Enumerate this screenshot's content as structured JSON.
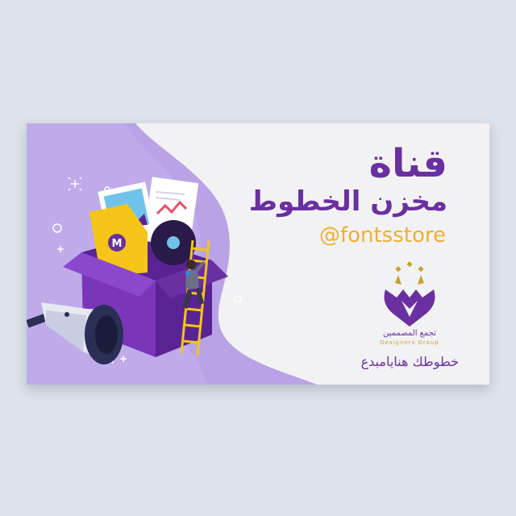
{
  "card": {
    "title_line1": "قناة",
    "title_line2": "مخزن الخطوط",
    "handle": "@fontsstore",
    "logo_arabic": "تجمع المصممين",
    "logo_english": "Designers Group",
    "slogan": "خطوطك هنايامبدع",
    "file_badge": "M"
  },
  "colors": {
    "background": "#dde3ea",
    "card": "#f2f2f4",
    "purple": "#6a2fa0",
    "lavender": "#b9a3e6",
    "gold": "#f0b02a"
  },
  "icons": [
    "megaphone-icon",
    "box-icon",
    "ladder-icon",
    "logo-mark"
  ]
}
